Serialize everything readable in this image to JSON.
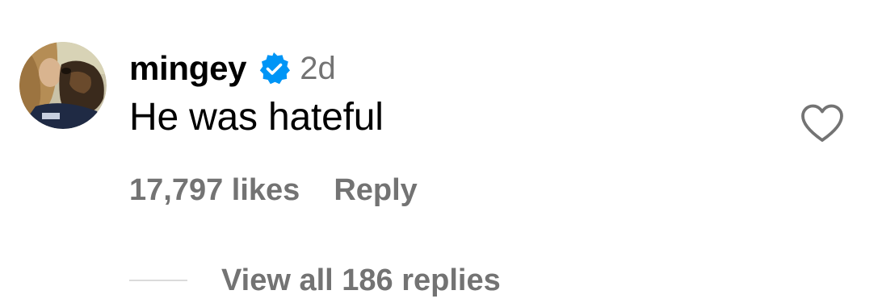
{
  "comment": {
    "avatar": "avatar-photo",
    "username": "mingey",
    "verified_icon": "verified-badge-icon",
    "timestamp": "2d",
    "text": "He was hateful",
    "likes_label": "17,797 likes",
    "reply_label": "Reply",
    "like_icon": "heart-outline-icon",
    "view_replies_label": "View all 186 replies"
  },
  "colors": {
    "text_primary": "#000000",
    "text_secondary": "#737373",
    "verified_blue": "#0095F6",
    "divider": "#DBDBDB"
  }
}
